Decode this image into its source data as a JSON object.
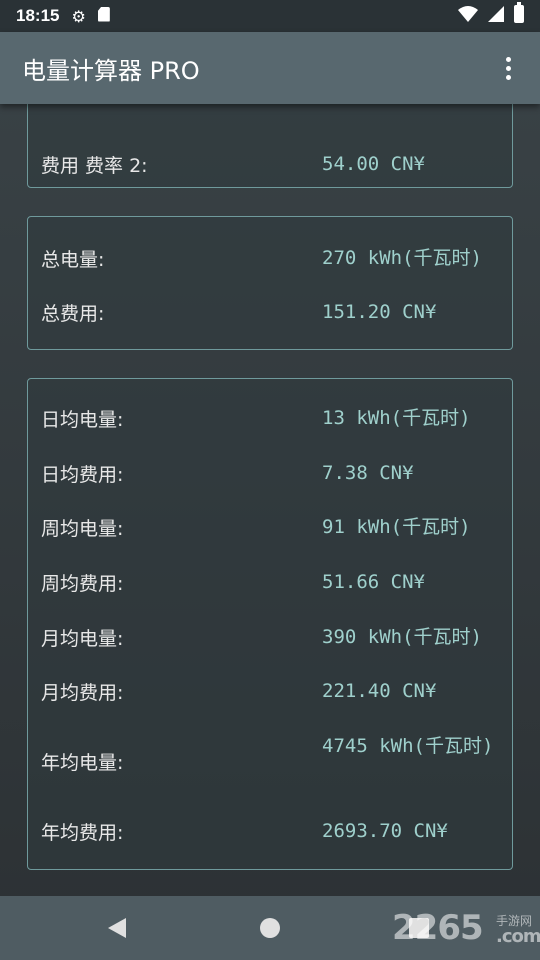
{
  "status_bar": {
    "time": "18:15",
    "icons": [
      "gear-icon",
      "sd-card-icon",
      "wifi-icon",
      "signal-icon",
      "battery-icon"
    ]
  },
  "app_bar": {
    "title": "电量计算器 PRO",
    "menu_icon": "more-vert-icon"
  },
  "card_rates": {
    "partial_value": "",
    "rows": [
      {
        "label": "费用 费率 2:",
        "value": "54.00 CN¥"
      }
    ]
  },
  "card_totals": {
    "rows": [
      {
        "label": "总电量:",
        "value": "270 kWh(千瓦时)"
      },
      {
        "label": "总费用:",
        "value": "151.20 CN¥"
      }
    ]
  },
  "card_averages": {
    "rows": [
      {
        "label": "日均电量:",
        "value": "13 kWh(千瓦时)"
      },
      {
        "label": "日均费用:",
        "value": "7.38 CN¥"
      },
      {
        "label": "周均电量:",
        "value": "91 kWh(千瓦时)"
      },
      {
        "label": "周均费用:",
        "value": "51.66 CN¥"
      },
      {
        "label": "月均电量:",
        "value": "390 kWh(千瓦时)"
      },
      {
        "label": "月均费用:",
        "value": "221.40 CN¥"
      },
      {
        "label": "年均电量:",
        "value": "4745 kWh(千瓦时)"
      },
      {
        "label": "年均费用:",
        "value": "2693.70 CN¥"
      }
    ]
  },
  "nav_bar": {
    "buttons": [
      "back-icon",
      "home-icon",
      "recents-icon"
    ]
  },
  "watermark": {
    "text": "2265",
    "sub": "手游网",
    "domain": ".com"
  },
  "colors": {
    "app_bar": "#58686f",
    "card_border": "#6f9a9c",
    "value_text": "#9fd0cc",
    "background": "#2c3134"
  }
}
